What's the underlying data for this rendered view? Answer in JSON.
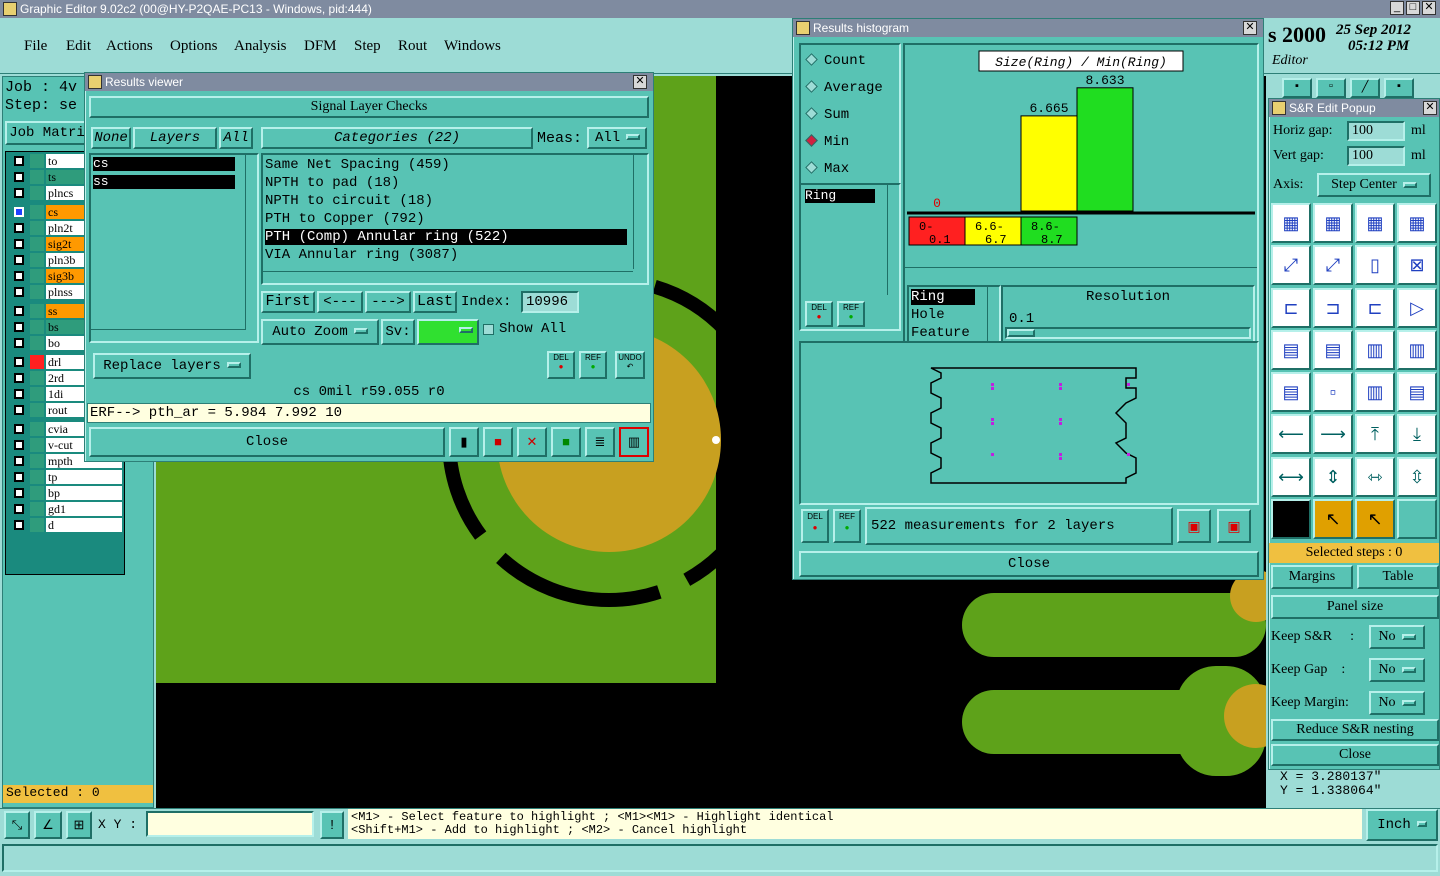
{
  "app": {
    "title": "Graphic Editor 9.02c2 (00@HY-P2QAE-PC13 - Windows, pid:444)"
  },
  "menu": [
    "File",
    "Edit",
    "Actions",
    "Options",
    "Analysis",
    "DFM",
    "Step",
    "Rout",
    "Windows"
  ],
  "main": {
    "job_label": "Job : 4v",
    "step_label": "Step: se",
    "job_matrix": "Job Matri",
    "date_prefix": "s 2000",
    "date": "25 Sep 2012",
    "time": "05:12 PM",
    "editor_label": "Editor",
    "selected": "Selected : 0",
    "coord_x": "X = 3.280137\"",
    "coord_y": "Y = 1.338064\"",
    "xy_label": "X Y :",
    "xy_value": "",
    "hint1": "<M1> - Select feature to highlight ; <M1><M1> - Highlight identical",
    "hint2": "<Shift+M1> - Add to highlight ; <M2> - Cancel highlight",
    "units": "Inch"
  },
  "layers": [
    {
      "name": "to",
      "color": "#ffffff"
    },
    {
      "name": "ts",
      "color": "#2f9c7c"
    },
    {
      "name": "plncs",
      "color": "#ffffff"
    },
    {
      "name": "cs",
      "color": "#ff9900"
    },
    {
      "name": "pln2t",
      "color": "#ffffff"
    },
    {
      "name": "sig2t",
      "color": "#ff9900"
    },
    {
      "name": "pln3b",
      "color": "#ffffff"
    },
    {
      "name": "sig3b",
      "color": "#ff9900"
    },
    {
      "name": "plnss",
      "color": "#ffffff"
    },
    {
      "name": "ss",
      "color": "#ff9900"
    },
    {
      "name": "bs",
      "color": "#2f9c7c"
    },
    {
      "name": "bo",
      "color": "#ffffff"
    },
    {
      "name": "drl",
      "color": "#ffffff"
    },
    {
      "name": "2rd",
      "color": "#ffffff"
    },
    {
      "name": "1di",
      "color": "#ffffff"
    },
    {
      "name": "rout",
      "color": "#ffffff"
    },
    {
      "name": "cvia",
      "color": "#ffffff"
    },
    {
      "name": "v-cut",
      "color": "#ffffff"
    },
    {
      "name": "mpth",
      "color": "#ffffff"
    },
    {
      "name": "tp",
      "color": "#ffffff"
    },
    {
      "name": "bp",
      "color": "#ffffff"
    },
    {
      "name": "gd1",
      "color": "#ffffff"
    },
    {
      "name": "d",
      "color": "#ffffff"
    }
  ],
  "results_viewer": {
    "title": "Results viewer",
    "header": "Signal Layer Checks",
    "none_btn": "None",
    "layers_btn": "Layers",
    "all_btn": "All",
    "layer_items": [
      "cs",
      "ss"
    ],
    "categories_label": "Categories (22)",
    "meas_label": "Meas:",
    "meas_value": "All",
    "categories": [
      "Same Net Spacing (459)",
      "NPTH to pad (18)",
      "NPTH to circuit (18)",
      "PTH to Copper (792)",
      "PTH (Comp) Annular ring (522)",
      "VIA Annular ring (3087)"
    ],
    "nav": {
      "first": "First",
      "prev": "<---",
      "next": "--->",
      "last": "Last",
      "index_label": "Index:",
      "index_value": "10996"
    },
    "auto_zoom": "Auto Zoom",
    "sv_label": "Sv:",
    "show_all": "Show All",
    "replace_layers": "Replace layers",
    "del": "DEL",
    "ref": "REF",
    "undo": "UNDO",
    "status": "cs 0mil r59.055 r0",
    "erf": "ERF--> pth_ar = 5.984 7.992 10",
    "close": "Close"
  },
  "histogram": {
    "title": "Results histogram",
    "modes": [
      "Count",
      "Average",
      "Sum",
      "Min",
      "Max"
    ],
    "selected_mode": "Min",
    "chart_title": "Size(Ring) / Min(Ring)",
    "list_item": "Ring",
    "bins": [
      "0-0.1",
      "6.6-6.7",
      "8.6-8.7"
    ],
    "bin_colors": [
      "#ff2020",
      "#ffff00",
      "#20dd20"
    ],
    "fields": [
      "Ring",
      "Hole",
      "Feature"
    ],
    "resolution_label": "Resolution",
    "resolution_value": "0.1",
    "measurements": "522 measurements for 2 layers",
    "del": "DEL",
    "ref": "REF",
    "close": "Close"
  },
  "chart_data": {
    "type": "bar",
    "title": "Size(Ring) / Min(Ring)",
    "categories": [
      "0-0.1",
      "6.6-6.7",
      "8.6-8.7"
    ],
    "values": [
      0,
      6.665,
      8.633
    ],
    "value_labels": [
      "0",
      "6.665",
      "8.633"
    ],
    "ylim": [
      0,
      10
    ],
    "grid": false
  },
  "sr_popup": {
    "title": "S&R Edit Popup",
    "horiz_label": "Horiz gap:",
    "horiz_value": "100",
    "vert_label": "Vert  gap:",
    "vert_value": "100",
    "unit": "ml",
    "axis_label": "Axis:",
    "axis_value": "Step Center",
    "selected_steps": "Selected steps : 0",
    "margins": "Margins",
    "table": "Table",
    "panel_size": "Panel size",
    "keep_sr": "Keep S&R",
    "keep_gap": "Keep Gap",
    "keep_margin": "Keep Margin:",
    "colon": ":",
    "no": "No",
    "reduce": "Reduce S&R nesting",
    "close": "Close"
  }
}
